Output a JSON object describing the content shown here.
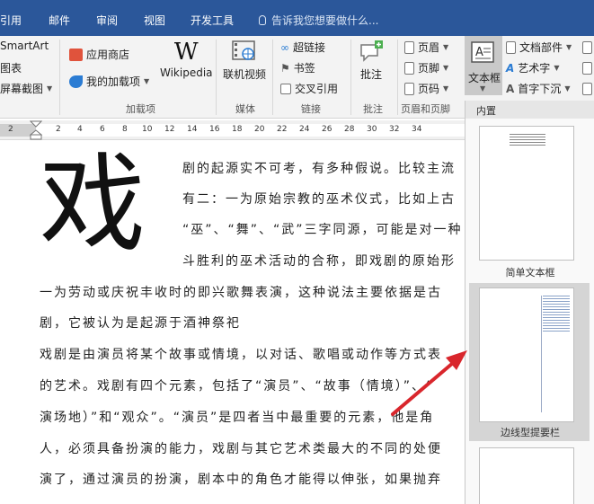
{
  "tabs": [
    "引用",
    "邮件",
    "审阅",
    "视图",
    "开发工具"
  ],
  "tell_me": "告诉我您想要做什么...",
  "ribbon": {
    "smartart": "SmartArt",
    "chart": "图表",
    "screenshot": "屏幕截图",
    "app_store": "应用商店",
    "my_addins": "我的加载项",
    "wikipedia_logo": "W",
    "wikipedia": "Wikipedia",
    "online_video": "联机视频",
    "hyperlink": "超链接",
    "bookmark": "书签",
    "cross_ref": "交叉引用",
    "comment": "批注",
    "header": "页眉",
    "footer": "页脚",
    "page_number": "页码",
    "textbox": "文本框",
    "quick_parts": "文档部件",
    "wordart": "艺术字",
    "dropcap": "首字下沉",
    "groups": {
      "addins": "加载项",
      "media": "媒体",
      "links": "链接",
      "comments": "批注",
      "header_footer": "页眉和页脚"
    }
  },
  "ruler_ticks": [
    "2",
    "2",
    "4",
    "6",
    "8",
    "10",
    "12",
    "14",
    "16",
    "18",
    "20",
    "22",
    "24",
    "26",
    "28",
    "30",
    "32",
    "34"
  ],
  "doc": {
    "dropcap": "戏",
    "lines": [
      "剧的起源实不可考，有多种假说。比较主流",
      "有二：一为原始宗教的巫术仪式，比如上古",
      "“巫”、“舞”、“武”三字同源，可能是对一种",
      "斗胜利的巫术活动的合称，即戏剧的原始形",
      "一为劳动或庆祝丰收时的即兴歌舞表演，这种说法主要依据是古",
      "剧，它被认为是起源于酒神祭祀",
      "戏剧是由演员将某个故事或情境，以对话、歌唱或动作等方式表",
      "的艺术。戏剧有四个元素，包括了“演员”、“故事（情境）”、“",
      "演场地）”和“观众”。“演员”是四者当中最重要的元素，他是角",
      "人，必须具备扮演的能力，戏剧与其它艺术类最大的不同的处便",
      "演了，通过演员的扮演，剧本中的角色才能得以伸张，如果抛弃"
    ]
  },
  "gallery": {
    "section": "内置",
    "items": [
      "简单文本框",
      "边线型提要栏"
    ]
  },
  "colors": {
    "tab_bar": "#2b579a",
    "arrow": "#d9262c",
    "selected": "#d5d5d5"
  }
}
